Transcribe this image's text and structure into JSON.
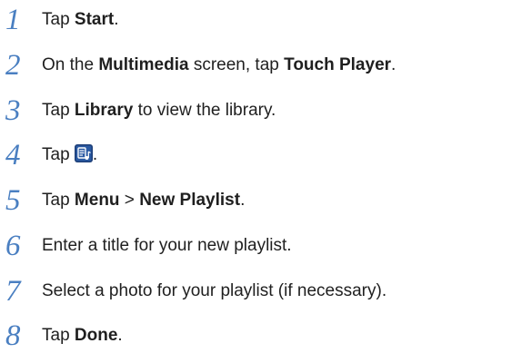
{
  "steps": [
    {
      "number": "1",
      "parts": [
        "Tap ",
        "Start",
        "."
      ]
    },
    {
      "number": "2",
      "parts": [
        "On the ",
        "Multimedia",
        " screen, tap ",
        "Touch Player",
        "."
      ]
    },
    {
      "number": "3",
      "parts": [
        "Tap ",
        "Library",
        " to view the library."
      ]
    },
    {
      "number": "4",
      "parts": [
        "Tap ",
        "."
      ],
      "icon": "playlist-icon"
    },
    {
      "number": "5",
      "parts": [
        "Tap ",
        "Menu",
        " > ",
        "New Playlist",
        "."
      ]
    },
    {
      "number": "6",
      "parts": [
        "Enter a title for your new playlist."
      ]
    },
    {
      "number": "7",
      "parts": [
        "Select a photo for your playlist (if necessary)."
      ]
    },
    {
      "number": "8",
      "parts": [
        "Tap ",
        "Done",
        "."
      ]
    }
  ],
  "colors": {
    "step_number": "#4a7fc1",
    "text": "#1f1f1f",
    "icon_background": "#1d3f78",
    "icon_foreground": "#ffffff"
  }
}
